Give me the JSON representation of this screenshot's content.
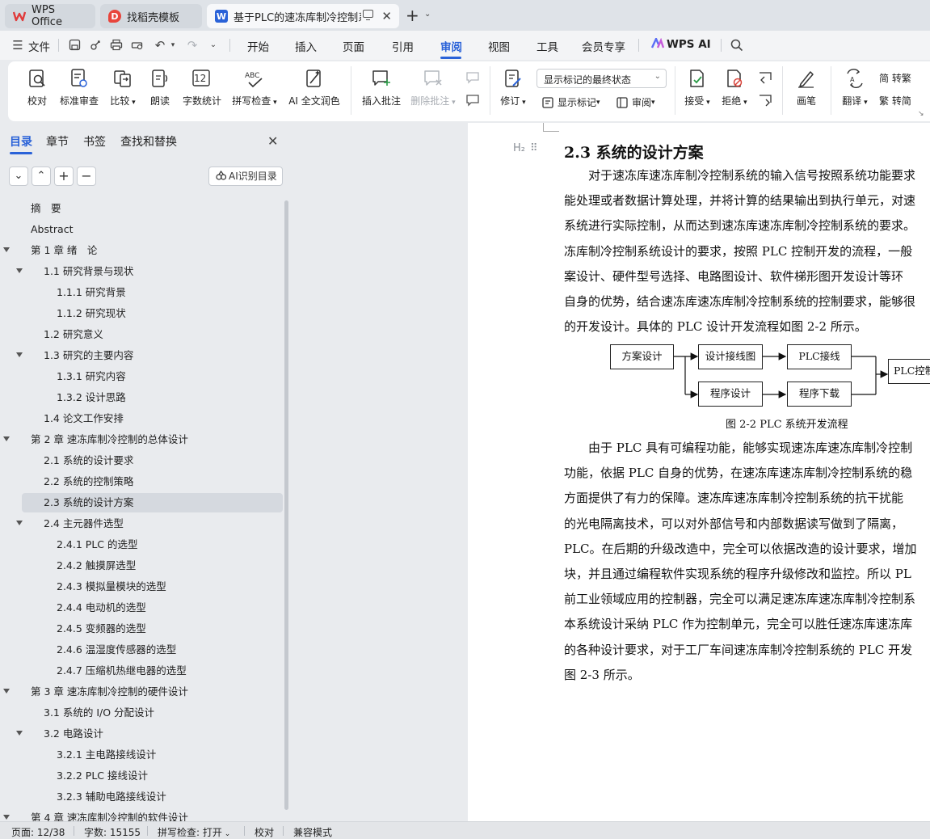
{
  "titlebar": {
    "tabs": [
      {
        "label": "WPS Office",
        "icon": "wps-logo-icon",
        "color": "#e03a3a",
        "active": false
      },
      {
        "label": "找稻壳模板",
        "icon": "docer-icon",
        "color": "#e8453c",
        "active": false
      },
      {
        "label": "基于PLC的速冻库制冷控制系统",
        "icon": "word-doc-icon",
        "color": "#2a62d8",
        "active": true
      }
    ]
  },
  "menubar": {
    "file_label": "文件",
    "items": [
      "开始",
      "插入",
      "页面",
      "引用",
      "审阅",
      "视图",
      "工具",
      "会员专享"
    ],
    "active_item": "审阅",
    "wps_ai_label": "WPS AI"
  },
  "ribbon": {
    "buttons": {
      "proofread": "校对",
      "standard_review": "标准审查",
      "compare": "比较",
      "read_aloud": "朗读",
      "word_count": "字数统计",
      "spell_check": "拼写检查",
      "ai_polish": "AI 全文润色",
      "insert_comment": "插入批注",
      "delete_comment": "删除批注",
      "track_changes": "修订",
      "show_markup": "显示标记",
      "review": "审阅",
      "accept": "接受",
      "reject": "拒绝",
      "pen": "画笔",
      "translate": "翻译",
      "to_traditional": "简 转繁",
      "to_simplified": "繁 转简"
    },
    "markup_combo": "显示标记的最终状态"
  },
  "nav": {
    "tabs": [
      "目录",
      "章节",
      "书签",
      "查找和替换"
    ],
    "active_tab": "目录",
    "ai_toc_button": "AI识别目录",
    "toc": [
      {
        "label": "摘　要",
        "level": 0,
        "arrow": false
      },
      {
        "label": "Abstract",
        "level": 0,
        "arrow": false
      },
      {
        "label": "第 1 章  绪　论",
        "level": 0,
        "arrow": true
      },
      {
        "label": "1.1  研究背景与现状",
        "level": 1,
        "arrow": true
      },
      {
        "label": "1.1.1  研究背景",
        "level": 2,
        "arrow": false
      },
      {
        "label": "1.1.2  研究现状",
        "level": 2,
        "arrow": false
      },
      {
        "label": "1.2  研究意义",
        "level": 1,
        "arrow": false
      },
      {
        "label": "1.3  研究的主要内容",
        "level": 1,
        "arrow": true
      },
      {
        "label": "1.3.1  研究内容",
        "level": 2,
        "arrow": false
      },
      {
        "label": "1.3.2  设计思路",
        "level": 2,
        "arrow": false
      },
      {
        "label": "1.4  论文工作安排",
        "level": 1,
        "arrow": false
      },
      {
        "label": "第 2 章  速冻库制冷控制的总体设计",
        "level": 0,
        "arrow": true
      },
      {
        "label": "2.1  系统的设计要求",
        "level": 1,
        "arrow": false
      },
      {
        "label": "2.2  系统的控制策略",
        "level": 1,
        "arrow": false
      },
      {
        "label": "2.3  系统的设计方案",
        "level": 1,
        "arrow": false,
        "selected": true
      },
      {
        "label": "2.4  主元器件选型",
        "level": 1,
        "arrow": true
      },
      {
        "label": "2.4.1 PLC 的选型",
        "level": 2,
        "arrow": false
      },
      {
        "label": "2.4.2  触摸屏选型",
        "level": 2,
        "arrow": false
      },
      {
        "label": "2.4.3  模拟量模块的选型",
        "level": 2,
        "arrow": false
      },
      {
        "label": "2.4.4  电动机的选型",
        "level": 2,
        "arrow": false
      },
      {
        "label": "2.4.5  变频器的选型",
        "level": 2,
        "arrow": false
      },
      {
        "label": "2.4.6  温湿度传感器的选型",
        "level": 2,
        "arrow": false
      },
      {
        "label": "2.4.7  压缩机热继电器的选型",
        "level": 2,
        "arrow": false
      },
      {
        "label": "第 3 章  速冻库制冷控制的硬件设计",
        "level": 0,
        "arrow": true
      },
      {
        "label": "3.1  系统的 I/O 分配设计",
        "level": 1,
        "arrow": false
      },
      {
        "label": "3.2  电路设计",
        "level": 1,
        "arrow": true
      },
      {
        "label": "3.2.1  主电路接线设计",
        "level": 2,
        "arrow": false
      },
      {
        "label": "3.2.2 PLC 接线设计",
        "level": 2,
        "arrow": false
      },
      {
        "label": "3.2.3  辅助电路接线设计",
        "level": 2,
        "arrow": false
      },
      {
        "label": "第 4 章  速冻库制冷控制的软件设计",
        "level": 0,
        "arrow": true
      }
    ]
  },
  "document": {
    "heading": "2.3  系统的设计方案",
    "para1": [
      "　　对于速冻库速冻库制冷控制系统的输入信号按照系统功能要求",
      "能处理或者数据计算处理，并将计算的结果输出到执行单元，对速",
      "系统进行实际控制，从而达到速冻库速冻库制冷控制系统的要求。",
      "冻库制冷控制系统设计的要求，按照 PLC 控制开发的流程，一般",
      "案设计、硬件型号选择、电路图设计、软件梯形图开发设计等环",
      "自身的优势，结合速冻库速冻库制冷控制系统的控制要求，能够很",
      "的开发设计。具体的 PLC 设计开发流程如图 2-2 所示。"
    ],
    "figure": {
      "boxes": {
        "scheme": "方案设计",
        "wiring": "设计接线图",
        "plc_wiring": "PLC接线",
        "program": "程序设计",
        "download": "程序下载",
        "plc_control": "PLC控制"
      },
      "caption": "图 2-2 PLC 系统开发流程"
    },
    "para2": [
      "　　由于 PLC 具有可编程功能，能够实现速冻库速冻库制冷控制",
      "功能，依据 PLC 自身的优势，在速冻库速冻库制冷控制系统的稳",
      "方面提供了有力的保障。速冻库速冻库制冷控制系统的抗干扰能",
      "的光电隔离技术，可以对外部信号和内部数据读写做到了隔离，",
      "PLC。在后期的升级改造中，完全可以依据改造的设计要求，增加",
      "块，并且通过编程软件实现系统的程序升级修改和监控。所以 PL",
      "前工业领域应用的控制器，完全可以满足速冻库速冻库制冷控制系",
      "本系统设计采纳 PLC 作为控制单元，完全可以胜任速冻库速冻库",
      "的各种设计要求，对于工厂车间速冻库制冷控制系统的 PLC 开发",
      "图 2-3 所示。"
    ]
  },
  "status": {
    "page": "页面: 12/38",
    "words": "字数: 15155",
    "spell": "拼写检查: 打开",
    "proof": "校对",
    "compat": "兼容模式"
  },
  "colors": {
    "accent": "#2a62d8",
    "wps_red": "#e03a3a"
  }
}
